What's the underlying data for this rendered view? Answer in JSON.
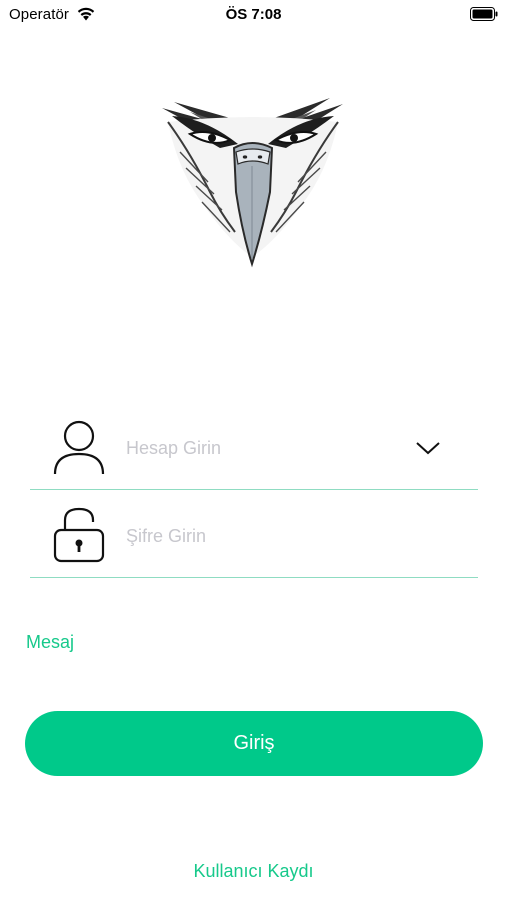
{
  "status_bar": {
    "carrier": "Operatör",
    "time": "ÖS 7:08",
    "wifi_icon": "wifi-icon",
    "battery_icon": "battery-icon"
  },
  "logo": {
    "icon": "eagle-head-logo"
  },
  "account_field": {
    "icon": "user-icon",
    "placeholder": "Hesap Girin",
    "value": "",
    "dropdown_icon": "chevron-down-icon"
  },
  "password_field": {
    "icon": "unlocked-padlock-icon",
    "placeholder": "Şifre Girin",
    "value": ""
  },
  "message_label": "Mesaj",
  "login_button": {
    "label": "Giriş"
  },
  "register_link": {
    "label": "Kullanıcı Kaydı"
  },
  "colors": {
    "accent": "#00c98a",
    "accent_text": "#17c98b",
    "divider": "#8fdcc2",
    "placeholder": "#c7c7cd"
  }
}
